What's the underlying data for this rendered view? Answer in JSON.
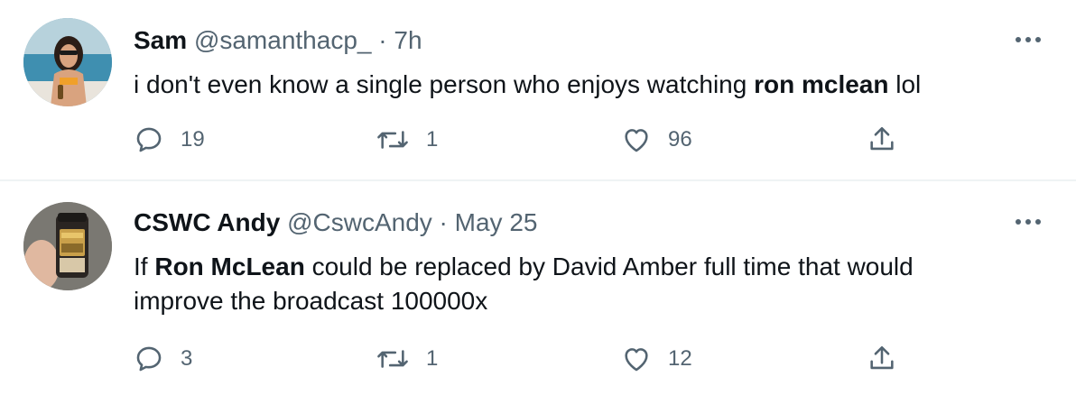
{
  "tweets": [
    {
      "name": "Sam",
      "handle": "@samanthacp_",
      "separator": "·",
      "time": "7h",
      "text_parts": [
        "i don't even know a single person who enjoys watching ",
        "ron mclean",
        " lol"
      ],
      "replies": "19",
      "retweets": "1",
      "likes": "96"
    },
    {
      "name": "CSWC Andy",
      "handle": "@CswcAndy",
      "separator": "·",
      "time": "May 25",
      "text_line1_parts": [
        "If ",
        "Ron McLean",
        " could be replaced by David Amber full time that would"
      ],
      "text_line2": "improve the broadcast 100000x",
      "replies": "3",
      "retweets": "1",
      "likes": "12"
    }
  ],
  "icons": {
    "more": "more-horizontal-icon",
    "reply": "reply-bubble-icon",
    "retweet": "retweet-icon",
    "like": "heart-icon",
    "share": "share-upload-icon"
  },
  "colors": {
    "text": "#0f1419",
    "secondary": "#536471",
    "divider": "#eff3f4"
  }
}
